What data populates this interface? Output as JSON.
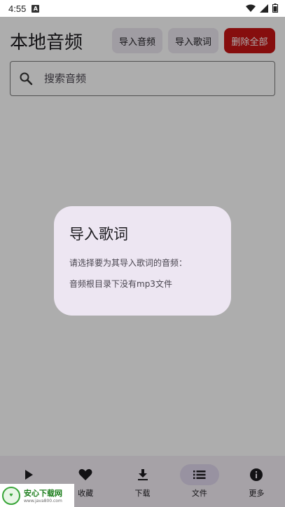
{
  "status_bar": {
    "time": "4:55",
    "app_notification_letter": "A"
  },
  "header": {
    "title": "本地音频",
    "import_audio_label": "导入音频",
    "import_lyrics_label": "导入歌词",
    "delete_all_label": "删除全部",
    "delete_color": "#c61515"
  },
  "search": {
    "placeholder": "搜索音频",
    "value": ""
  },
  "dialog": {
    "title": "导入歌词",
    "prompt": "请选择要为其导入歌词的音频：",
    "message": "音频根目录下没有mp3文件"
  },
  "bottom_nav": {
    "items": [
      {
        "label": "",
        "icon": "play-icon"
      },
      {
        "label": "收藏",
        "icon": "heart-icon"
      },
      {
        "label": "下载",
        "icon": "download-icon"
      },
      {
        "label": "文件",
        "icon": "list-icon",
        "active": true
      },
      {
        "label": "更多",
        "icon": "info-icon"
      }
    ]
  },
  "watermark": {
    "name": "安心下载网",
    "url": "www.java800.com"
  }
}
